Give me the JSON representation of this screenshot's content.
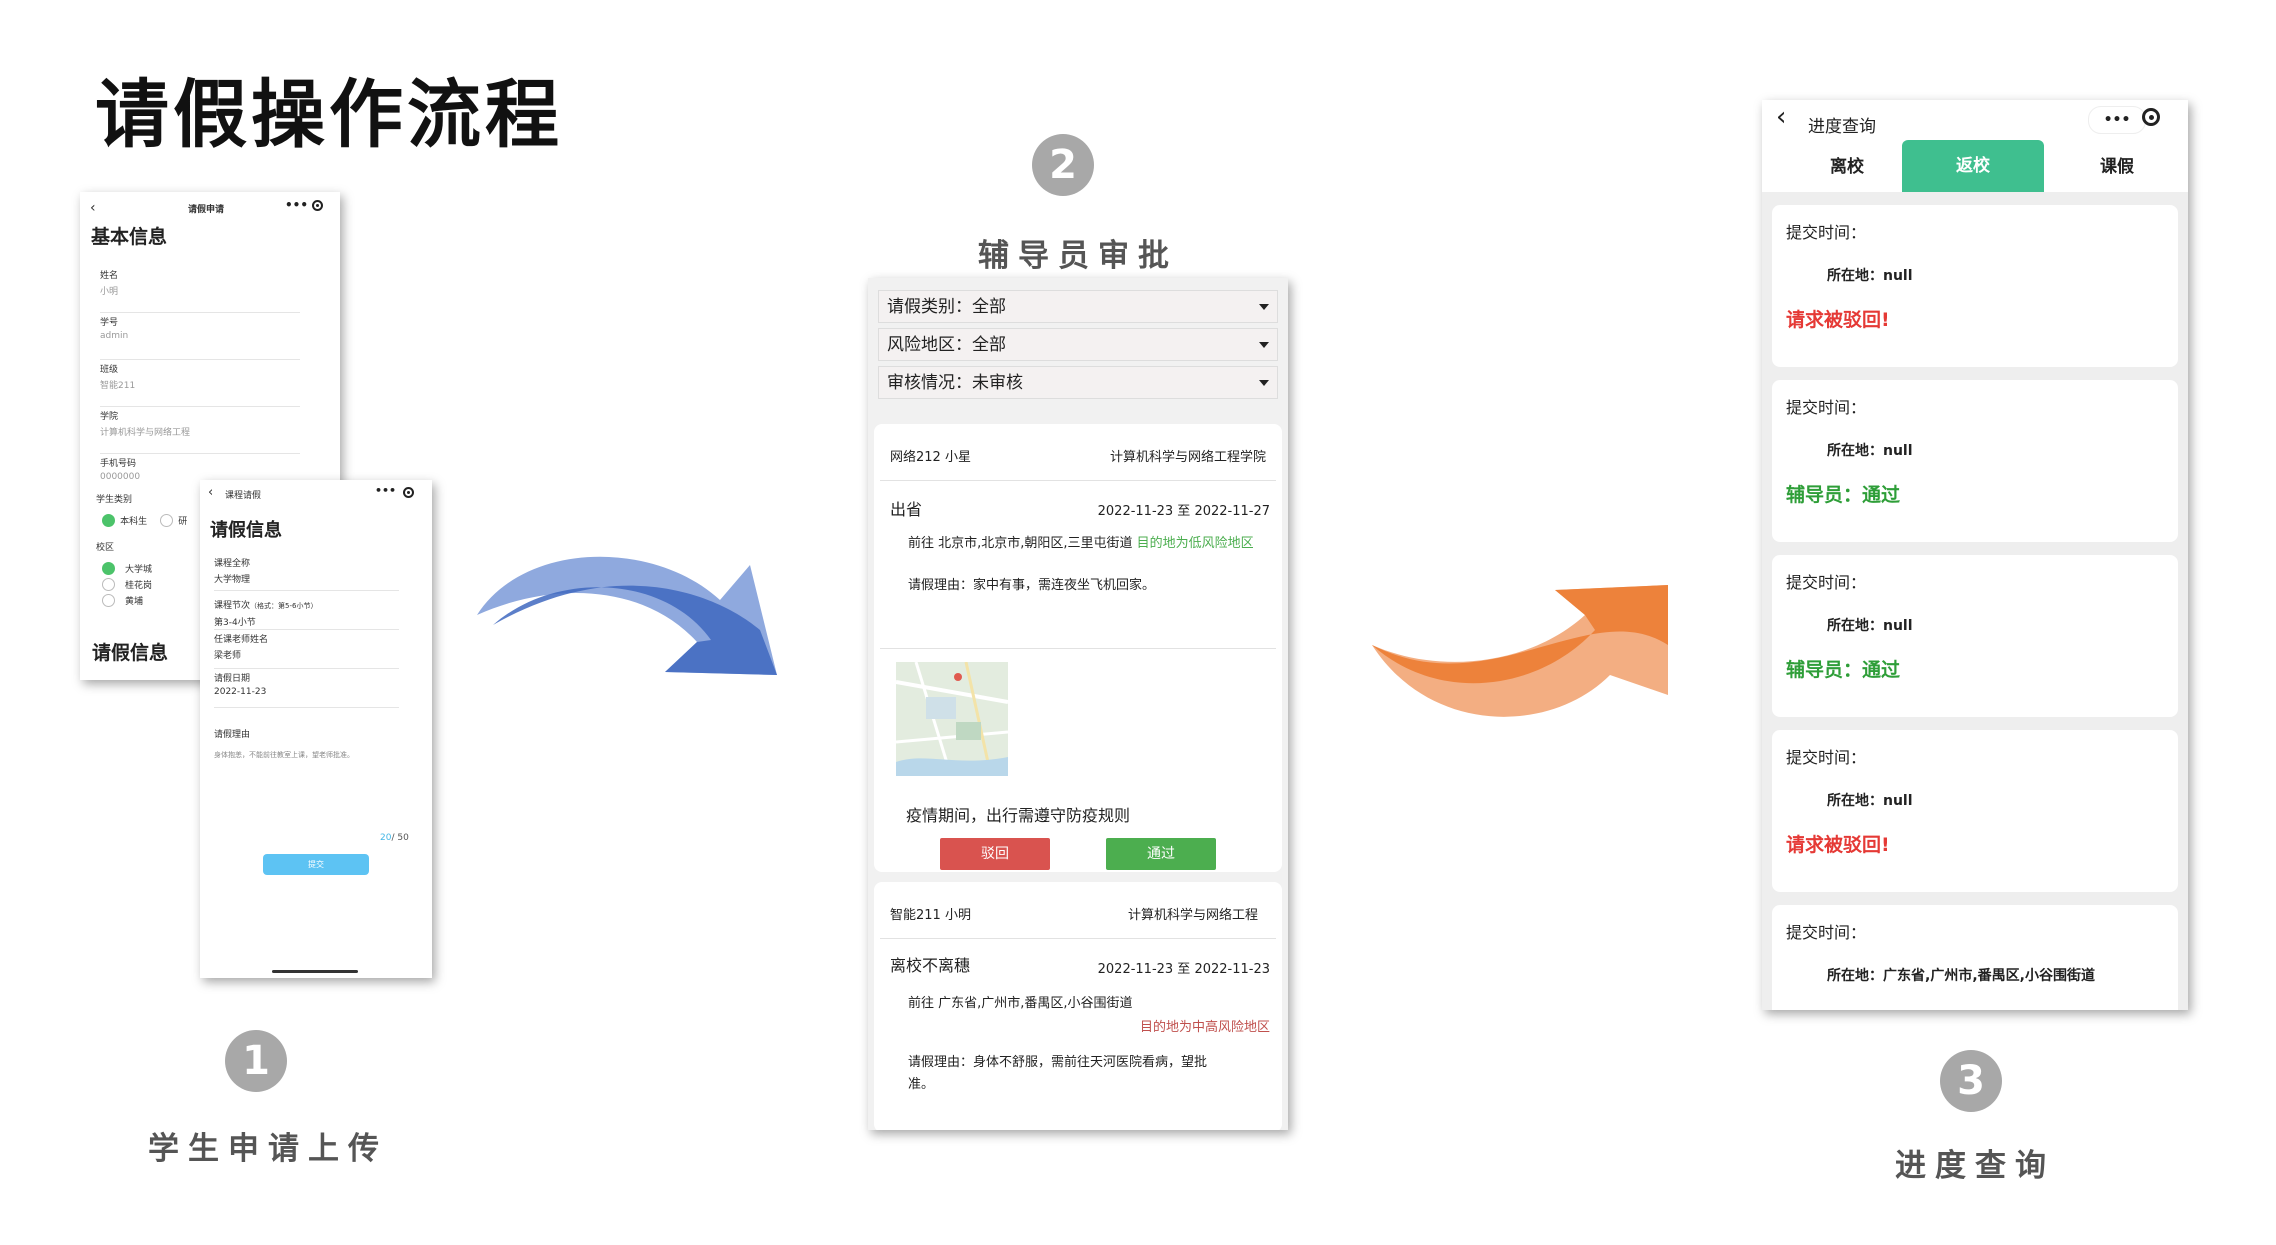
{
  "page": {
    "title": "请假操作流程"
  },
  "steps": [
    {
      "num": "1",
      "label": "学生申请上传"
    },
    {
      "num": "2",
      "label": "辅导员审批"
    },
    {
      "num": "3",
      "label": "进度查询"
    }
  ],
  "colors": {
    "arrow1": "#4a72c4",
    "arrow2": "#ef7d32",
    "green": "#4cae4f",
    "red": "#d9534f",
    "teal": "#3fbf8f"
  },
  "phone1": {
    "nav_title": "请假申请",
    "section": "基本信息",
    "fields": [
      {
        "label": "姓名",
        "value": "小明"
      },
      {
        "label": "学号",
        "value": "admin"
      },
      {
        "label": "班级",
        "value": "智能211"
      },
      {
        "label": "学院",
        "value": "计算机科学与网络工程"
      },
      {
        "label": "手机号码",
        "value": "0000000"
      }
    ],
    "student_type_label": "学生类别",
    "student_types": [
      "本科生",
      "研"
    ],
    "campus_label": "校区",
    "campuses": [
      "大学城",
      "桂花岗",
      "黄埔"
    ],
    "section2": "请假信息"
  },
  "phone2": {
    "nav_title": "课程请假",
    "section": "请假信息",
    "fields": [
      {
        "label": "课程全称",
        "value": "大学物理"
      },
      {
        "label": "课程节次",
        "hint": "（格式：第5-6小节）",
        "value": "第3-4小节"
      },
      {
        "label": "任课老师姓名",
        "value": "梁老师"
      },
      {
        "label": "请假日期",
        "value": "2022-11-23"
      }
    ],
    "reason_label": "请假理由",
    "reason_value": "身体抱恙，不能前往教室上课，望老师批准。",
    "counter_now": "20",
    "counter_max": "/ 50",
    "submit_label": "提交"
  },
  "approval": {
    "filters": [
      "请假类别：全部",
      "风险地区：全部",
      "审核情况：未审核"
    ],
    "cards": [
      {
        "class_name": "网络212 小星",
        "college": "计算机科学与网络工程学院",
        "type": "出省",
        "dates": "2022-11-23 至 2022-11-27",
        "dest": "前往 北京市,北京市,朝阳区,三里屯街道",
        "risk": "目的地为低风险地区",
        "reason": "请假理由：家中有事，需连夜坐飞机回家。",
        "notice": "疫情期间，出行需遵守防疫规则",
        "reject": "驳回",
        "approve": "通过"
      },
      {
        "class_name": "智能211 小明",
        "college": "计算机科学与网络工程",
        "type": "离校不离穗",
        "dates": "2022-11-23 至 2022-11-23",
        "dest": "前往 广东省,广州市,番禺区,小谷围街道",
        "risk": "目的地为中高风险地区",
        "reason_line1": "请假理由：身体不舒服，需前往天河医院看病，望批",
        "reason_line2": "准。"
      }
    ]
  },
  "progress": {
    "nav_title": "进度查询",
    "tabs": [
      "离校",
      "返校",
      "课假"
    ],
    "active_tab": "返校",
    "records": [
      {
        "submit": "提交时间：",
        "location": "所在地：null",
        "status": "请求被驳回!",
        "ok": false
      },
      {
        "submit": "提交时间：",
        "location": "所在地：null",
        "status": "辅导员：通过",
        "ok": true
      },
      {
        "submit": "提交时间：",
        "location": "所在地：null",
        "status": "辅导员：通过",
        "ok": true
      },
      {
        "submit": "提交时间：",
        "location": "所在地：null",
        "status": "请求被驳回!",
        "ok": false
      },
      {
        "submit": "提交时间：",
        "location": "所在地：广东省,广州市,番禺区,小谷围街道"
      }
    ]
  },
  "icons": [
    "back-chevron-icon",
    "more-dots-icon",
    "capsule-target-icon",
    "check-icon",
    "dropdown-caret-icon",
    "map-icon"
  ]
}
